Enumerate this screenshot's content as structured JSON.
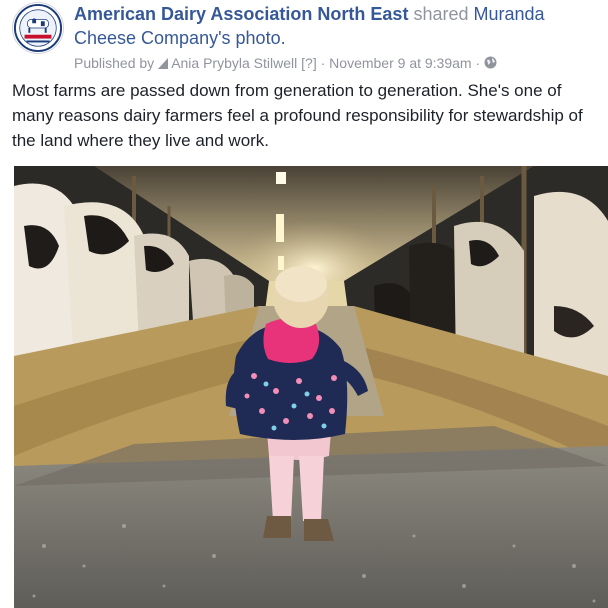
{
  "post": {
    "author": "American Dairy Association North East",
    "action": "shared",
    "source_page": "Muranda Cheese Company",
    "source_suffix": "'s photo.",
    "published_by_label": "Published by",
    "publisher": "Ania Prybyla Stilwell",
    "publisher_help": "[?]",
    "separator": "·",
    "timestamp": "November 9 at 9:39am",
    "audience_icon": "globe-icon",
    "text": "Most farms are passed down from generation to generation. She's one of many reasons dairy farmers feel a profound responsibility for stewardship of the land where they live and work."
  },
  "logo": {
    "text": "AMERICAN DAIRY ASSOCIATION NORTH EAST"
  },
  "colors": {
    "link": "#365899",
    "meta": "#90949c",
    "body_text": "#1d2129",
    "jacket": "#1f2a55",
    "hood": "#e8337a"
  }
}
